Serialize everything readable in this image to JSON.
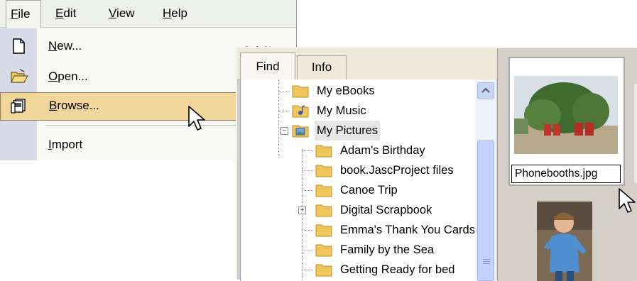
{
  "menubar": {
    "items": [
      {
        "label": "File",
        "key": "F",
        "rest": "ile"
      },
      {
        "label": "Edit",
        "key": "E",
        "rest": "dit"
      },
      {
        "label": "View",
        "key": "V",
        "rest": "iew"
      },
      {
        "label": "Help",
        "key": "H",
        "rest": "elp"
      }
    ]
  },
  "file_menu": {
    "new": {
      "key": "N",
      "rest": "ew..."
    },
    "open": {
      "key": "O",
      "rest": "pen..."
    },
    "browse": {
      "key": "B",
      "rest": "rowse..."
    },
    "import": {
      "key": "I",
      "rest": "mport"
    },
    "new_shortcut": "Ctrl+N"
  },
  "browser": {
    "tabs": [
      "Find",
      "Info"
    ],
    "tree": [
      "My eBooks",
      "My Music",
      "My Pictures",
      "Adam's Birthday",
      "book.JascProject files",
      "Canoe Trip",
      "Digital Scrapbook",
      "Emma's Thank You Cards",
      "Family by the Sea",
      "Getting Ready for bed"
    ],
    "thumbnail_caption": "Phonebooths.jpg"
  },
  "colors": {
    "highlight": "#f0d69a",
    "menu_gutter": "#d8dbe7",
    "folder": "#f2c75c"
  }
}
